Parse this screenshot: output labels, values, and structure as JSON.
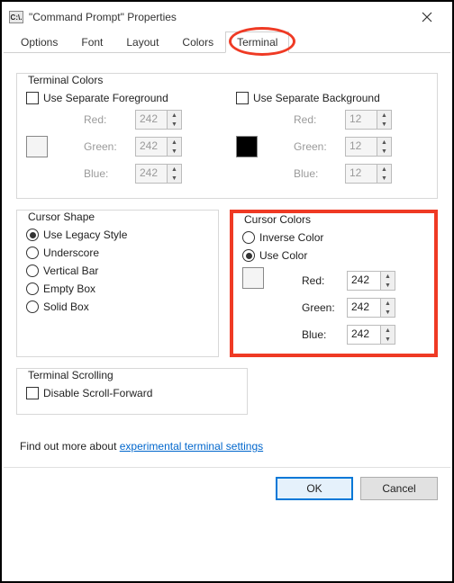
{
  "window": {
    "title": "\"Command Prompt\" Properties",
    "icon_text": "C:\\."
  },
  "tabs": {
    "items": [
      {
        "label": "Options"
      },
      {
        "label": "Font"
      },
      {
        "label": "Layout"
      },
      {
        "label": "Colors"
      },
      {
        "label": "Terminal"
      }
    ],
    "active_index": 4
  },
  "terminal_colors": {
    "title": "Terminal Colors",
    "fg_checkbox": "Use Separate Foreground",
    "bg_checkbox": "Use Separate Background",
    "fg": {
      "red_label": "Red:",
      "green_label": "Green:",
      "blue_label": "Blue:",
      "red": "242",
      "green": "242",
      "blue": "242"
    },
    "bg": {
      "red_label": "Red:",
      "green_label": "Green:",
      "blue_label": "Blue:",
      "red": "12",
      "green": "12",
      "blue": "12"
    }
  },
  "cursor_shape": {
    "title": "Cursor Shape",
    "options": [
      {
        "label": "Use Legacy Style",
        "checked": true
      },
      {
        "label": "Underscore",
        "checked": false
      },
      {
        "label": "Vertical Bar",
        "checked": false
      },
      {
        "label": "Empty Box",
        "checked": false
      },
      {
        "label": "Solid Box",
        "checked": false
      }
    ]
  },
  "cursor_colors": {
    "title": "Cursor Colors",
    "inverse": {
      "label": "Inverse Color",
      "checked": false
    },
    "use_color": {
      "label": "Use Color",
      "checked": true
    },
    "red_label": "Red:",
    "green_label": "Green:",
    "blue_label": "Blue:",
    "red": "242",
    "green": "242",
    "blue": "242"
  },
  "terminal_scrolling": {
    "title": "Terminal Scrolling",
    "disable_scroll_label": "Disable Scroll-Forward"
  },
  "link": {
    "prefix": "Find out more about ",
    "text": "experimental terminal settings"
  },
  "buttons": {
    "ok": "OK",
    "cancel": "Cancel"
  }
}
